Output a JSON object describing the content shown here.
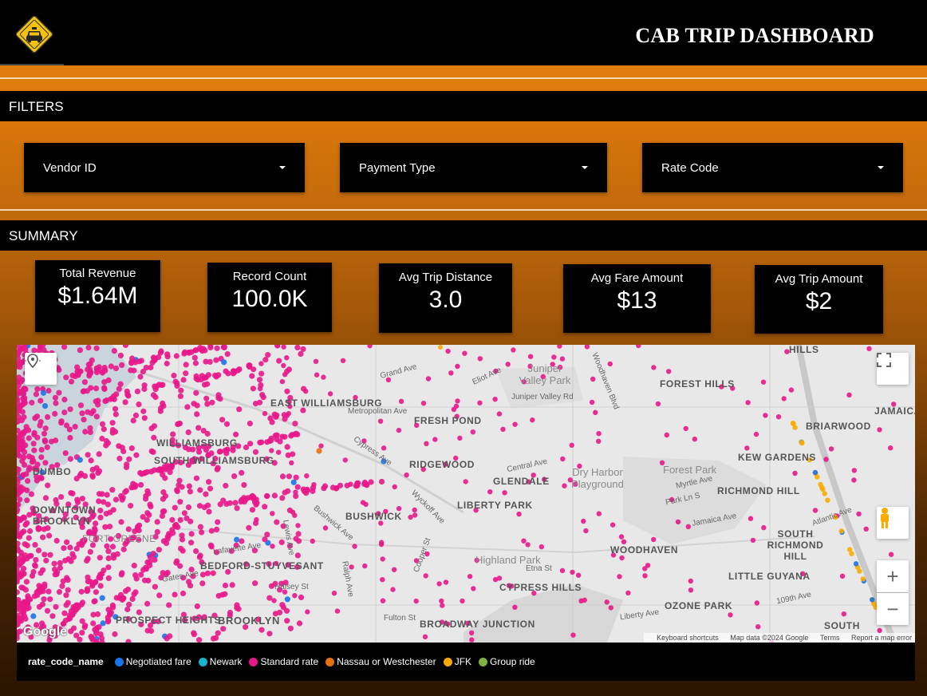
{
  "header": {
    "title": "CAB TRIP DASHBOARD",
    "logo_icon": "taxi-sign-icon"
  },
  "filters": {
    "section_title": "FILTERS",
    "dropdowns": [
      {
        "label": "Vendor ID"
      },
      {
        "label": "Payment Type"
      },
      {
        "label": "Rate Code"
      }
    ]
  },
  "summary": {
    "section_title": "SUMMARY",
    "kpis": [
      {
        "label": "Total Revenue",
        "value": "$1.64M"
      },
      {
        "label": "Record Count",
        "value": "100.0K"
      },
      {
        "label": "Avg Trip Distance",
        "value": "3.0"
      },
      {
        "label": "Avg Fare Amount",
        "value": "$13"
      },
      {
        "label": "Avg Trip Amount",
        "value": "$2"
      }
    ]
  },
  "map": {
    "neighborhoods": [
      "EAST WILLIAMSBURG",
      "WILLIAMSBURG",
      "SOUTH WILLIAMSBURG",
      "DUMBO",
      "DOWNTOWN BROOKLYN",
      "FORT GREENE",
      "BEDFORD-STUYVESANT",
      "BUSHWICK",
      "BROOKLYN",
      "PROSPECT HEIGHTS",
      "BROADWAY JUNCTION",
      "FRESH POND",
      "RIDGEWOOD",
      "GLENDALE",
      "LIBERTY PARK",
      "CYPRESS HILLS",
      "WOODHAVEN",
      "FOREST HILLS",
      "KEW GARDENS",
      "RICHMOND HILL",
      "SOUTH RICHMOND HILL",
      "LITTLE GUYANA",
      "OZONE PARK",
      "BRIARWOOD",
      "JAMAICA",
      "HILLS",
      "SOUTH"
    ],
    "parks": [
      "Juniper Valley Park",
      "Dry Harbor Playground",
      "Forest Park",
      "Highland Park"
    ],
    "streets": [
      "Grand Ave",
      "Eliot Ave",
      "Juniper Valley Rd",
      "Metropolitan Ave",
      "Central Ave",
      "Cypress Ave",
      "Myrtle Ave",
      "Park Ln S",
      "Jamaica Ave",
      "Atlantic Ave",
      "Fulton St",
      "Halsey St",
      "Lewis Ave",
      "Ralph Ave",
      "Bushwick Ave",
      "Wyckoff Ave",
      "Lafayette Ave",
      "Gates Ave",
      "Woodhaven Blvd",
      "Liberty Ave",
      "109th Ave",
      "Etna St",
      "Cooper St"
    ],
    "attribution": {
      "shortcuts": "Keyboard shortcuts",
      "data": "Map data ©2024 Google",
      "terms": "Terms",
      "report": "Report a map error"
    },
    "google_mark": "Google",
    "zoom_in": "+",
    "zoom_out": "−"
  },
  "legend": {
    "title": "rate_code_name",
    "items": [
      {
        "label": "Negotiated fare",
        "color": "#1a73e8"
      },
      {
        "label": "Newark",
        "color": "#12b5cb"
      },
      {
        "label": "Standard rate",
        "color": "#e8178a"
      },
      {
        "label": "Nassau or Westchester",
        "color": "#e8710a"
      },
      {
        "label": "JFK",
        "color": "#f9ab00"
      },
      {
        "label": "Group ride",
        "color": "#7cb342"
      }
    ]
  }
}
